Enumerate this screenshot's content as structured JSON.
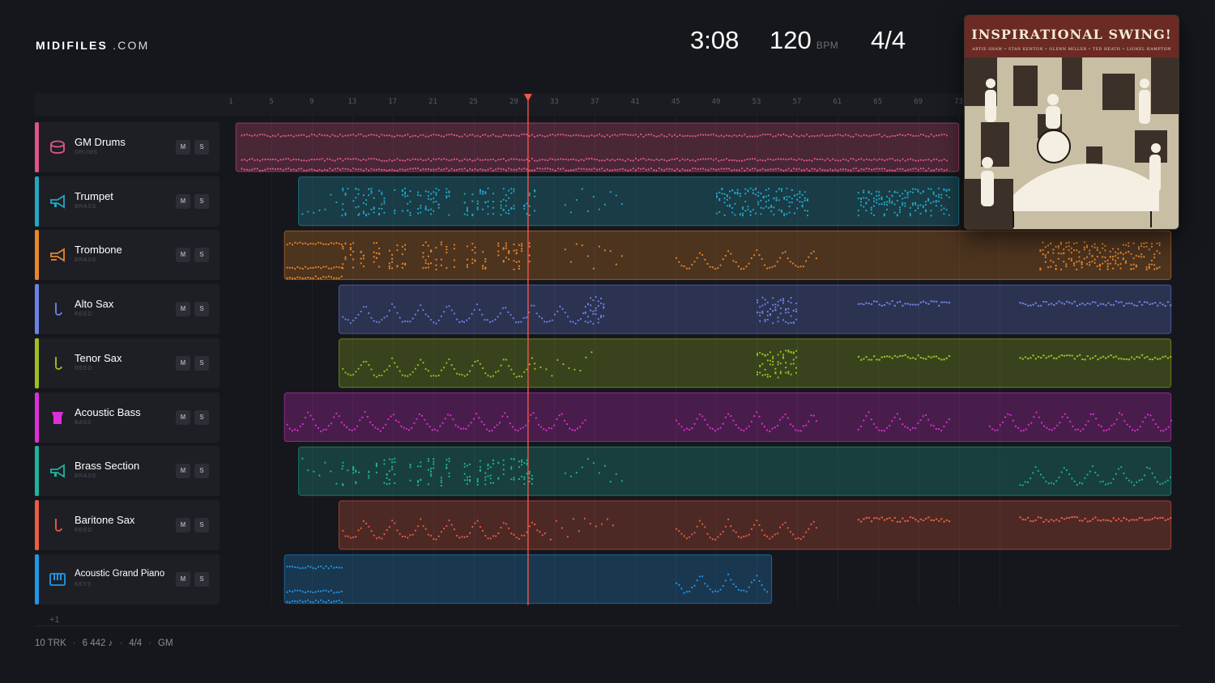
{
  "brand": {
    "name": "MIDIFILES",
    "suffix": ".COM"
  },
  "header": {
    "time": "3:08",
    "tempo": "120",
    "tempo_unit": "BPM",
    "signature": "4/4"
  },
  "album": {
    "title": "INSPIRATIONAL SWING!",
    "artists": "ARTIE SHAW • STAN KENTON • GLENN MILLER • TED HEATH • LIONEL HAMPTON"
  },
  "ruler": {
    "bars": [
      "1",
      "5",
      "9",
      "13",
      "17",
      "21",
      "25",
      "29",
      "33",
      "37",
      "41",
      "45",
      "49",
      "53",
      "57",
      "61",
      "65",
      "69",
      "73"
    ]
  },
  "playhead_bar": 30.4,
  "tracks": [
    {
      "name": "GM Drums",
      "category": "DRUMS",
      "color": "#e05586",
      "icon": "drum-icon",
      "mute": "M",
      "solo": "S"
    },
    {
      "name": "Trumpet",
      "category": "BRASS",
      "color": "#22a8c4",
      "icon": "trumpet-icon",
      "mute": "M",
      "solo": "S"
    },
    {
      "name": "Trombone",
      "category": "BRASS",
      "color": "#e8862a",
      "icon": "trombone-icon",
      "mute": "M",
      "solo": "S"
    },
    {
      "name": "Alto Sax",
      "category": "REED",
      "color": "#6c82e6",
      "icon": "saxophone-icon",
      "mute": "M",
      "solo": "S"
    },
    {
      "name": "Tenor Sax",
      "category": "REED",
      "color": "#9cc024",
      "icon": "saxophone-icon",
      "mute": "M",
      "solo": "S"
    },
    {
      "name": "Acoustic Bass",
      "category": "BASS",
      "color": "#de2fd6",
      "icon": "bass-icon",
      "mute": "M",
      "solo": "S"
    },
    {
      "name": "Brass Section",
      "category": "BRASS",
      "color": "#1fb39a",
      "icon": "trumpet-icon",
      "mute": "M",
      "solo": "S"
    },
    {
      "name": "Baritone Sax",
      "category": "REED",
      "color": "#ea5d42",
      "icon": "saxophone-icon",
      "mute": "M",
      "solo": "S"
    },
    {
      "name": "Acoustic Grand Piano",
      "category": "KEYS",
      "color": "#2196e8",
      "icon": "piano-icon",
      "mute": "M",
      "solo": "S"
    }
  ],
  "add_track": "+1",
  "footer": {
    "tracks": "10 TRK",
    "notes": "6 442 ♪",
    "signature": "4/4",
    "standard": "GM"
  }
}
